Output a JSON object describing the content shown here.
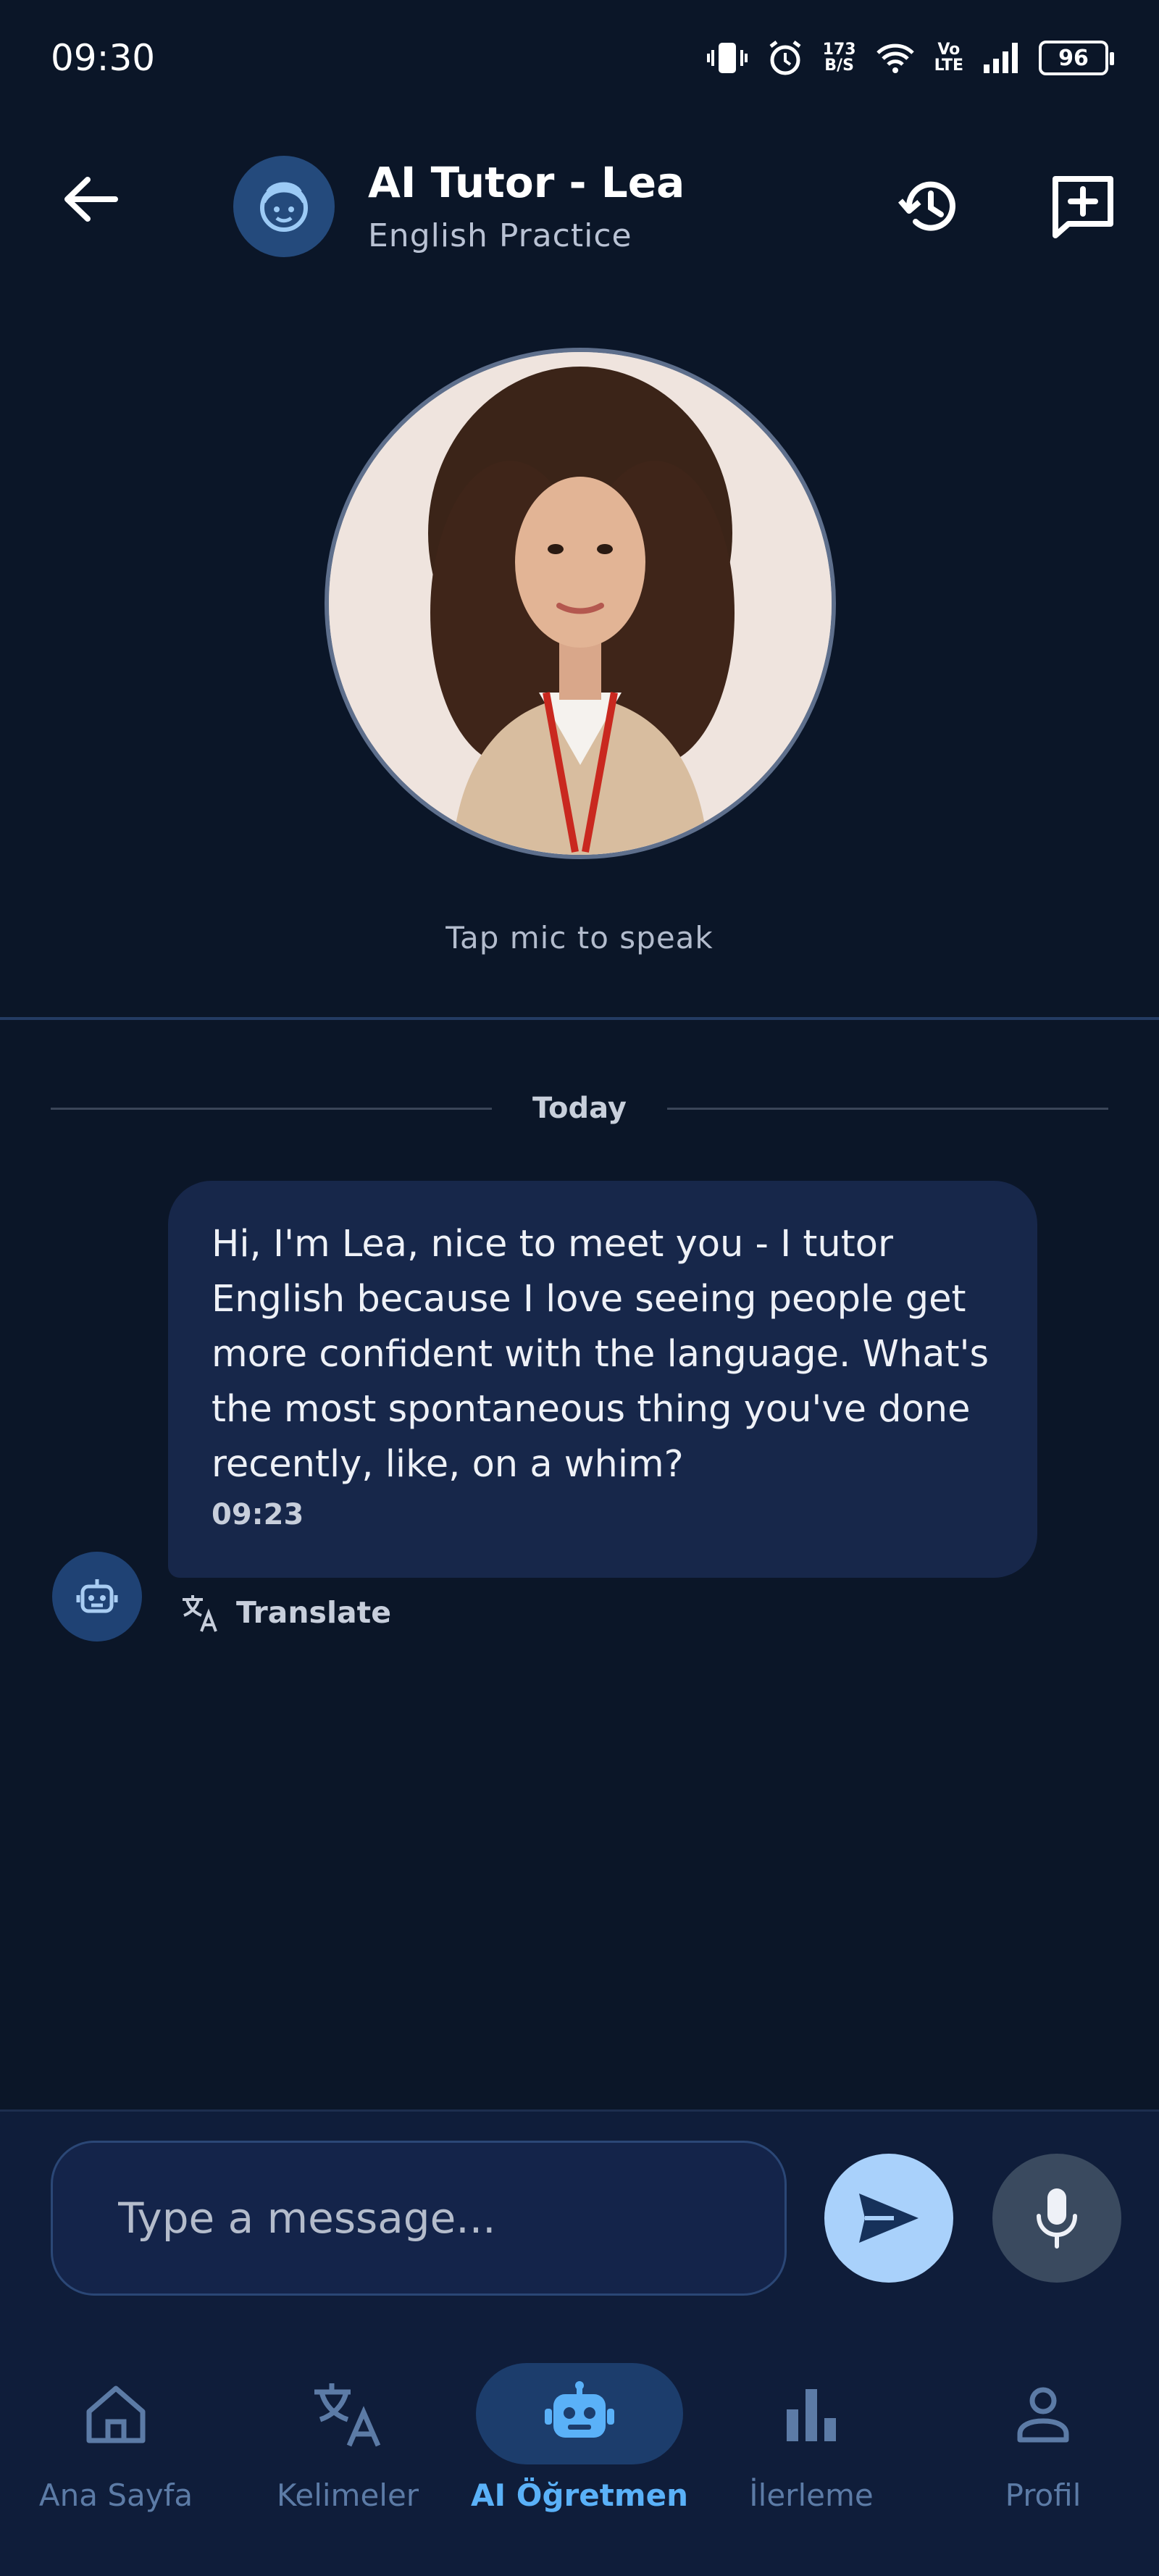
{
  "status_bar": {
    "time": "09:30",
    "net_speed_value": "173",
    "net_speed_unit": "B/S",
    "volte_top": "Vo",
    "volte_bottom": "LTE",
    "battery": "96"
  },
  "header": {
    "title": "AI Tutor - Lea",
    "subtitle": "English Practice"
  },
  "avatar_hint": "Tap mic to speak",
  "chat": {
    "date_label": "Today",
    "messages": [
      {
        "sender": "bot",
        "text": "Hi, I'm Lea, nice to meet you - I tutor English because I love seeing people get more confident with the language. What's the most spontaneous thing you've done recently, like, on a whim?",
        "time": "09:23",
        "translate_label": "Translate"
      }
    ]
  },
  "composer": {
    "placeholder": "Type a message..."
  },
  "bottom_nav": {
    "items": [
      {
        "label": "Ana Sayfa",
        "icon": "home-icon"
      },
      {
        "label": "Kelimeler",
        "icon": "translate-icon"
      },
      {
        "label": "AI Öğretmen",
        "icon": "robot-icon",
        "active": true
      },
      {
        "label": "İlerleme",
        "icon": "bar-chart-icon"
      },
      {
        "label": "Profil",
        "icon": "person-icon"
      }
    ]
  },
  "colors": {
    "background": "#0b1628",
    "bubble": "#17274a",
    "accent": "#5ab1f8",
    "send_button": "#a9d1fb"
  }
}
